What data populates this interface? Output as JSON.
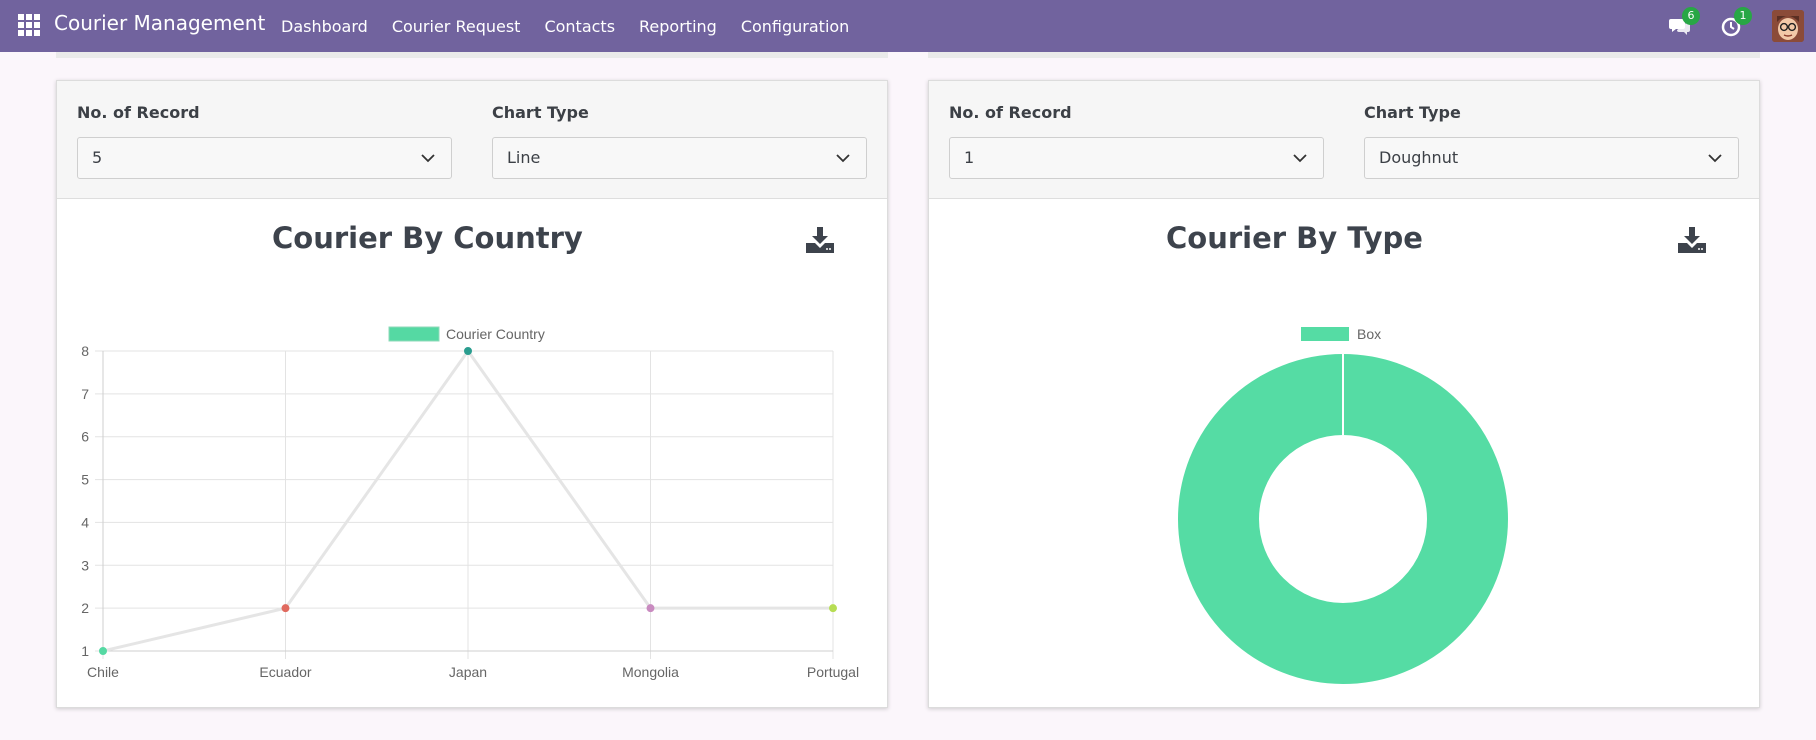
{
  "app": {
    "title": "Courier Management"
  },
  "menu": [
    "Dashboard",
    "Courier Request",
    "Contacts",
    "Reporting",
    "Configuration"
  ],
  "systray": {
    "messages_count": "6",
    "activities_count": "1"
  },
  "cards": [
    {
      "record_label": "No. of Record",
      "record_value": "5",
      "chart_type_label": "Chart Type",
      "chart_type_value": "Line",
      "title": "Courier By Country"
    },
    {
      "record_label": "No. of Record",
      "record_value": "1",
      "chart_type_label": "Chart Type",
      "chart_type_value": "Doughnut",
      "title": "Courier By Type"
    }
  ],
  "chart_data": [
    {
      "type": "line",
      "title": "Courier By Country",
      "categories": [
        "Chile",
        "Ecuador",
        "Japan",
        "Mongolia",
        "Portugal"
      ],
      "series": [
        {
          "name": "Courier Country",
          "values": [
            1,
            2,
            8,
            2,
            2
          ]
        }
      ],
      "yticks": [
        1,
        2,
        3,
        4,
        5,
        6,
        7,
        8
      ],
      "ylim": [
        1,
        8
      ],
      "grid": true,
      "legend": "top",
      "colors": {
        "legend_fill": "#55d9a3",
        "line": "#e5e5e5",
        "points": [
          "#55d9a3",
          "#e06a5f",
          "#2a9d8f",
          "#c98bc0",
          "#b7dd54"
        ]
      }
    },
    {
      "type": "pie",
      "title": "Courier By Type",
      "labels": [
        "Box"
      ],
      "values": [
        1
      ],
      "legend": "top",
      "colors": [
        "#55dca4"
      ]
    }
  ]
}
